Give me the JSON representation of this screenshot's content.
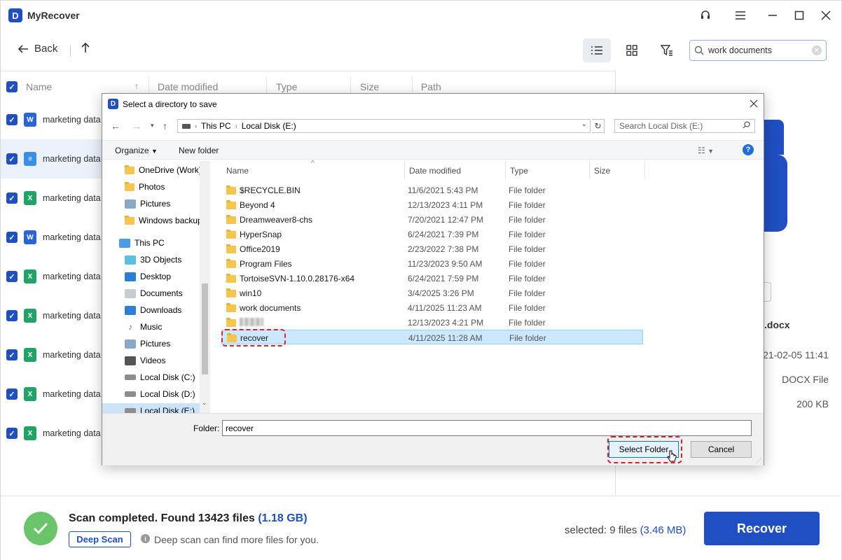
{
  "app": {
    "title": "MyRecover",
    "logo": "D"
  },
  "toolbar": {
    "back_label": "Back",
    "search_value": "work documents"
  },
  "list": {
    "columns": [
      "Name",
      "Date modified",
      "Type",
      "Size",
      "Path"
    ],
    "rows": [
      {
        "name": "marketing data (",
        "kind": "word",
        "color": "#2b63d9",
        "glyph": "W"
      },
      {
        "name": "marketing data (",
        "kind": "doc",
        "color": "#3a8ee6",
        "glyph": "≡"
      },
      {
        "name": "marketing data (",
        "kind": "excel",
        "color": "#21a366",
        "glyph": "X"
      },
      {
        "name": "marketing data (",
        "kind": "word",
        "color": "#2b63d9",
        "glyph": "W"
      },
      {
        "name": "marketing data (",
        "kind": "excel",
        "color": "#21a366",
        "glyph": "X"
      },
      {
        "name": "marketing data (",
        "kind": "excel",
        "color": "#21a366",
        "glyph": "X"
      },
      {
        "name": "marketing data (",
        "kind": "excel",
        "color": "#21a366",
        "glyph": "X"
      },
      {
        "name": "marketing data (",
        "kind": "excel",
        "color": "#21a366",
        "glyph": "X"
      },
      {
        "name": "marketing data (",
        "kind": "excel",
        "color": "#21a366",
        "glyph": "X"
      }
    ]
  },
  "preview": {
    "filename_suffix": ".docx",
    "date": "21-02-05 11:41",
    "type": "DOCX File",
    "size": "200 KB"
  },
  "footer": {
    "scan_text": "Scan completed. Found 13423 files",
    "scan_size": "(1.18 GB)",
    "deep_scan_label": "Deep Scan",
    "deep_hint": "Deep scan can find more files for you.",
    "selected_label": "selected: 9 files",
    "selected_size": "(3.46 MB)",
    "recover_label": "Recover"
  },
  "dialog": {
    "title": "Select a directory to save",
    "breadcrumb": [
      "This PC",
      "Local Disk (E:)"
    ],
    "search_placeholder": "Search Local Disk (E:)",
    "organize_label": "Organize",
    "new_folder_label": "New folder",
    "nav_items": [
      {
        "label": "OneDrive (Work)",
        "icon": "folder-icon"
      },
      {
        "label": "Photos",
        "icon": "folder-icon"
      },
      {
        "label": "Pictures",
        "icon": "pictures-icon"
      },
      {
        "label": "Windows backup",
        "icon": "folder-icon"
      },
      {
        "label": "This PC",
        "icon": "pc-icon"
      },
      {
        "label": "3D Objects",
        "icon": "cube-icon"
      },
      {
        "label": "Desktop",
        "icon": "desktop-icon"
      },
      {
        "label": "Documents",
        "icon": "documents-icon"
      },
      {
        "label": "Downloads",
        "icon": "downloads-icon"
      },
      {
        "label": "Music",
        "icon": "music-icon"
      },
      {
        "label": "Pictures",
        "icon": "pictures-icon"
      },
      {
        "label": "Videos",
        "icon": "videos-icon"
      },
      {
        "label": "Local Disk (C:)",
        "icon": "drive-icon"
      },
      {
        "label": "Local Disk (D:)",
        "icon": "drive-icon"
      },
      {
        "label": "Local Disk (E:)",
        "icon": "drive-icon"
      }
    ],
    "file_columns": [
      "Name",
      "Date modified",
      "Type",
      "Size"
    ],
    "files": [
      {
        "name": "$RECYCLE.BIN",
        "date": "11/6/2021 5:43 PM",
        "type": "File folder"
      },
      {
        "name": "Beyond 4",
        "date": "12/13/2023 4:11 PM",
        "type": "File folder"
      },
      {
        "name": "Dreamweaver8-chs",
        "date": "7/20/2021 12:47 PM",
        "type": "File folder"
      },
      {
        "name": "HyperSnap",
        "date": "6/24/2021 7:39 PM",
        "type": "File folder"
      },
      {
        "name": "Office2019",
        "date": "2/23/2022 7:38 PM",
        "type": "File folder"
      },
      {
        "name": "Program Files",
        "date": "11/23/2023 9:50 AM",
        "type": "File folder"
      },
      {
        "name": "TortoiseSVN-1.10.0.28176-x64",
        "date": "6/24/2021 7:59 PM",
        "type": "File folder"
      },
      {
        "name": "win10",
        "date": "3/4/2025 3:26 PM",
        "type": "File folder"
      },
      {
        "name": "work documents",
        "date": "4/11/2025 11:23 AM",
        "type": "File folder"
      },
      {
        "name": "",
        "date": "12/13/2023 4:21 PM",
        "type": "File folder"
      },
      {
        "name": "recover",
        "date": "4/11/2025 11:28 AM",
        "type": "File folder"
      }
    ],
    "folder_label": "Folder:",
    "folder_value": "recover",
    "select_label": "Select Folder",
    "cancel_label": "Cancel"
  }
}
